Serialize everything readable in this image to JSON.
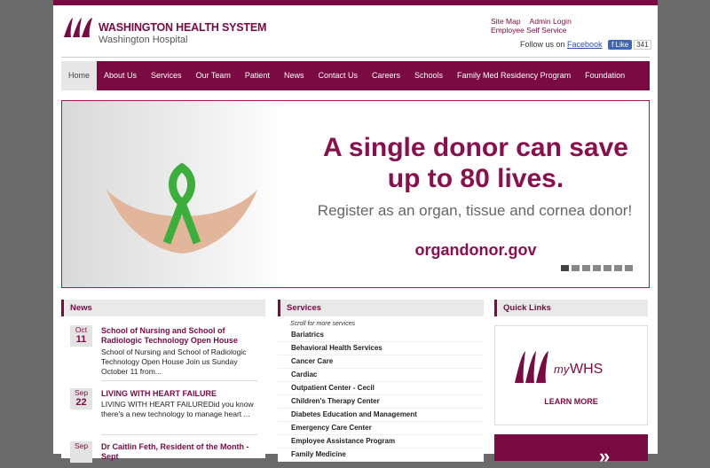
{
  "header": {
    "brand_title": "WASHINGTON HEALTH SYSTEM",
    "brand_subtitle": "Washington Hospital",
    "links": [
      "Site Map",
      "Admin Login",
      "Employee Self Service"
    ],
    "follow_text": "Follow us on",
    "facebook": "Facebook",
    "like_label": "Like",
    "like_count": "341",
    "brand_color": "#7a0a42"
  },
  "nav": {
    "items": [
      "Home",
      "About Us",
      "Services",
      "Our Team",
      "Patient",
      "News",
      "Contact Us",
      "Careers",
      "Schools",
      "Family Med Residency Program",
      "Foundation"
    ],
    "active_index": 0
  },
  "hero": {
    "headline": "A single donor can save up to 80 lives.",
    "subline": "Register as an organ, tissue and cornea donor!",
    "url": "organdonor.gov",
    "slide_count": 7,
    "active_slide": 1
  },
  "news": {
    "title": "News",
    "items": [
      {
        "month": "Oct",
        "day": "11",
        "title": "School of Nursing and School of Radiologic Technology Open House",
        "body": "School of Nursing and School of Radiologic Technology Open House Join us Sunday October 11 from..."
      },
      {
        "month": "Sep",
        "day": "22",
        "title": "LIVING WITH HEART FAILURE",
        "body": "LIVING WITH HEART FAILUREDid you know there’s a new technology to manage heart ..."
      },
      {
        "month": "Sep",
        "day": "",
        "title": "Dr Caitlin Feth, Resident of the Month - Sept",
        "body": ""
      }
    ]
  },
  "services": {
    "title": "Services",
    "scroll_note": "Scroll for more services",
    "items": [
      "Bariatrics",
      "Behavioral Health Services",
      "Cancer Care",
      "Cardiac",
      "Outpatient Center - Cecil",
      "Children's Therapy Center",
      "Diabetes Education and Management",
      "Emergency Care Center",
      "Employee Assistance Program",
      "Family Medicine"
    ]
  },
  "quick_links": {
    "title": "Quick Links",
    "my_label": "my",
    "whs_label": "WHS",
    "learn_more": "LEARN MORE"
  }
}
